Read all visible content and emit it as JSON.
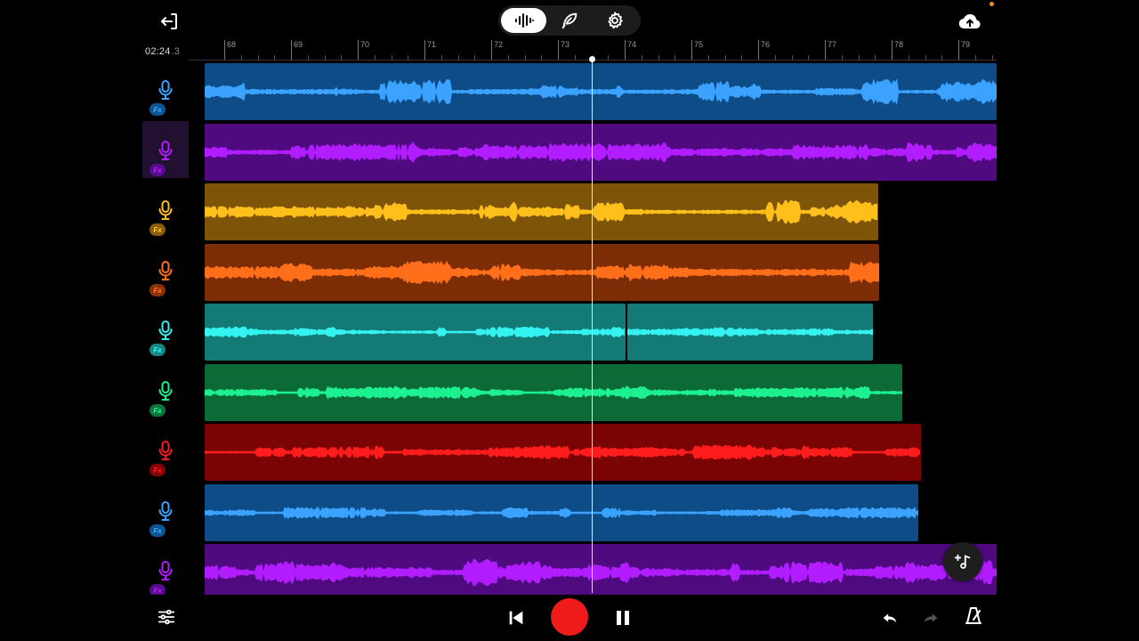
{
  "timeline": {
    "time_main": "02:24",
    "time_frac": ".3",
    "bar_start": 68,
    "bar_end": 79,
    "playhead_bar": 73.42
  },
  "mode_buttons": [
    {
      "name": "waveform-mode",
      "icon": "waveform-icon",
      "active": true
    },
    {
      "name": "quill-mode",
      "icon": "quill-icon",
      "active": false
    },
    {
      "name": "settings",
      "icon": "gear-icon",
      "active": false
    }
  ],
  "fx_label": "Fx",
  "tracks": [
    {
      "id": 1,
      "color": "#3ba3ff",
      "bg": "#0d4c86",
      "selected": false,
      "clips": [
        [
          67.62,
          79.7
        ]
      ],
      "seed": 11,
      "amp": 0.55
    },
    {
      "id": 2,
      "color": "#b21dff",
      "bg": "#4f0a80",
      "selected": true,
      "clips": [
        [
          67.62,
          79.7
        ]
      ],
      "seed": 23,
      "amp": 0.45
    },
    {
      "id": 3,
      "color": "#ffbf1a",
      "bg": "#7d5408",
      "selected": false,
      "clips": [
        [
          67.62,
          77.72
        ]
      ],
      "seed": 37,
      "amp": 0.5
    },
    {
      "id": 4,
      "color": "#ff6f1a",
      "bg": "#7d2d05",
      "selected": false,
      "clips": [
        [
          67.62,
          77.74
        ]
      ],
      "seed": 41,
      "amp": 0.55
    },
    {
      "id": 5,
      "color": "#33f2f0",
      "bg": "#137a76",
      "selected": false,
      "clips": [
        [
          67.62,
          73.93
        ],
        [
          73.96,
          77.64
        ]
      ],
      "seed": 53,
      "amp": 0.3
    },
    {
      "id": 6,
      "color": "#1cf08f",
      "bg": "#0b6a35",
      "selected": false,
      "clips": [
        [
          67.62,
          78.08
        ]
      ],
      "seed": 67,
      "amp": 0.3
    },
    {
      "id": 7,
      "color": "#ff1c1c",
      "bg": "#7a0303",
      "selected": false,
      "clips": [
        [
          67.62,
          78.36
        ]
      ],
      "seed": 71,
      "amp": 0.32
    },
    {
      "id": 8,
      "color": "#3ba3ff",
      "bg": "#0d4c86",
      "selected": false,
      "clips": [
        [
          67.62,
          78.32
        ]
      ],
      "seed": 83,
      "amp": 0.25
    },
    {
      "id": 9,
      "color": "#b21dff",
      "bg": "#4f0a80",
      "selected": false,
      "clips": [
        [
          67.62,
          79.7
        ]
      ],
      "seed": 97,
      "amp": 0.6
    }
  ],
  "icons": {
    "exit": "exit-icon",
    "upload": "cloud-upload-icon",
    "mixer": "sliders-icon",
    "rewind": "skip-back-icon",
    "record": "record-icon",
    "pause": "pause-icon",
    "undo": "undo-icon",
    "redo": "redo-icon",
    "metronome": "metronome-icon",
    "add_track": "add-track-icon"
  }
}
